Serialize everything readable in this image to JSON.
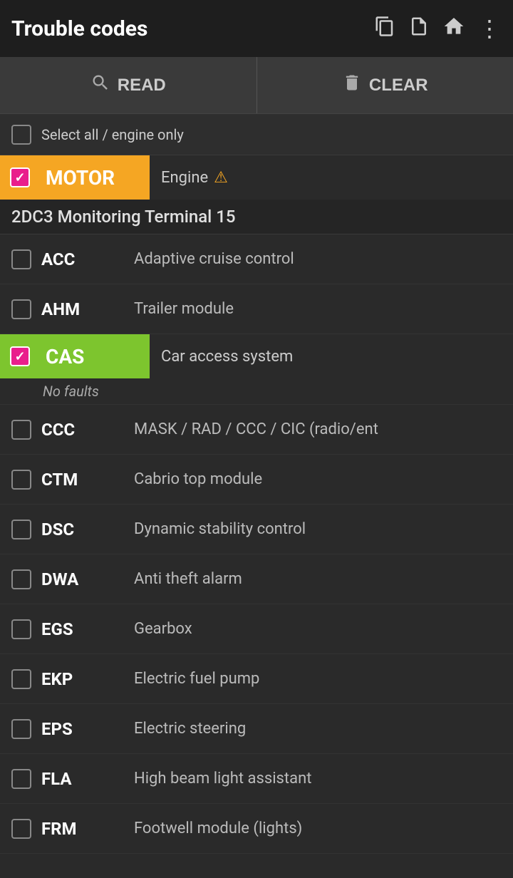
{
  "header": {
    "title": "Trouble codes",
    "icons": [
      "copy",
      "file",
      "home",
      "more"
    ]
  },
  "toolbar": {
    "read_icon": "🔍",
    "read_label": "READ",
    "clear_icon": "🗑",
    "clear_label": "CLEAR"
  },
  "select_all": {
    "label": "Select all / engine only",
    "checked": false
  },
  "motor_module": {
    "tag": "MOTOR",
    "checked": true,
    "description": "Engine",
    "has_warning": true
  },
  "sub_header": {
    "text": "2DC3 Monitoring Terminal 15"
  },
  "systems": [
    {
      "code": "ACC",
      "name": "Adaptive cruise control",
      "checked": false,
      "selected": false,
      "has_faults": false
    },
    {
      "code": "AHM",
      "name": "Trailer module",
      "checked": false,
      "selected": false,
      "has_faults": false
    },
    {
      "code": "CAS",
      "name": "Car access system",
      "checked": true,
      "selected": true,
      "has_faults": false,
      "no_faults_label": "No faults"
    },
    {
      "code": "CCC",
      "name": "MASK / RAD / CCC / CIC (radio/ent",
      "checked": false,
      "selected": false,
      "has_faults": false
    },
    {
      "code": "CTM",
      "name": "Cabrio top module",
      "checked": false,
      "selected": false,
      "has_faults": false
    },
    {
      "code": "DSC",
      "name": "Dynamic stability control",
      "checked": false,
      "selected": false,
      "has_faults": false
    },
    {
      "code": "DWA",
      "name": "Anti theft alarm",
      "checked": false,
      "selected": false,
      "has_faults": false
    },
    {
      "code": "EGS",
      "name": "Gearbox",
      "checked": false,
      "selected": false,
      "has_faults": false
    },
    {
      "code": "EKP",
      "name": "Electric fuel pump",
      "checked": false,
      "selected": false,
      "has_faults": false
    },
    {
      "code": "EPS",
      "name": "Electric steering",
      "checked": false,
      "selected": false,
      "has_faults": false
    },
    {
      "code": "FLA",
      "name": "High beam light assistant",
      "checked": false,
      "selected": false,
      "has_faults": false
    },
    {
      "code": "FRM",
      "name": "Footwell module (lights)",
      "checked": false,
      "selected": false,
      "has_faults": false
    }
  ]
}
